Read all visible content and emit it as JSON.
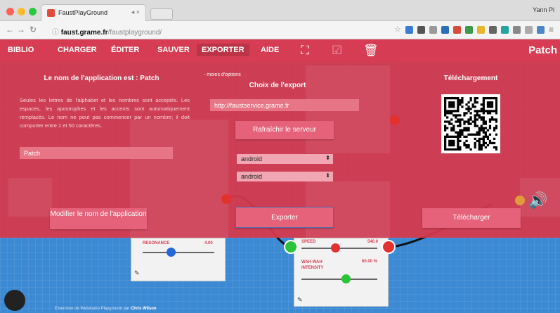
{
  "browser": {
    "tab_title": "FaustPlayGround",
    "tab_close": "◂ ×",
    "user_label": "Yann Pi",
    "url_host": "faust.grame.fr",
    "url_path": "/faustplayground/"
  },
  "menu": {
    "items": [
      "BIBLIO",
      "CHARGER",
      "ÉDITER",
      "SAUVER",
      "EXPORTER",
      "AIDE"
    ],
    "patch_name": "Patch"
  },
  "overlay": {
    "left": {
      "title": "Le nom de l'application est : Patch",
      "help": "Seules les lettres de l'alphabet et les nombres sont acceptés. Les espaces, les apostrophes et les accents sont automatiquement remplacés. Le nom ne peut pas commencer par un nombre; il doit comporter entre 1 et 50 caractères.",
      "name_value": "Patch",
      "modify_button": "Modifier le nom de l'application"
    },
    "middle": {
      "less_options": "- moins d'options",
      "title": "Choix de l'export",
      "server_url": "http://faustservice.grame.fr",
      "refresh_button": "Rafraîchir le serveur",
      "platform": "android",
      "architecture": "android",
      "export_button": "Exporter"
    },
    "right": {
      "title": "Téléchargement",
      "download_button": "Télécharger"
    }
  },
  "modules": {
    "resonance_label": "RESONANCE",
    "resonance_value": "4.00",
    "speed_label": "SPEED",
    "speed_value": "540.0",
    "wah_label": "WAH WAH INTENSITY",
    "wah_value": "60.00 %"
  },
  "footer": {
    "text": "Extension de WebAudio Playground par",
    "author": "Chris Wilson"
  },
  "colors": {
    "menu_red": "#d63c53",
    "overlay_red": "#d8384a",
    "canvas_blue": "#3c89d4",
    "port_green": "#2cc23a",
    "port_red": "#e53030",
    "knob_blue": "#2467d8"
  }
}
